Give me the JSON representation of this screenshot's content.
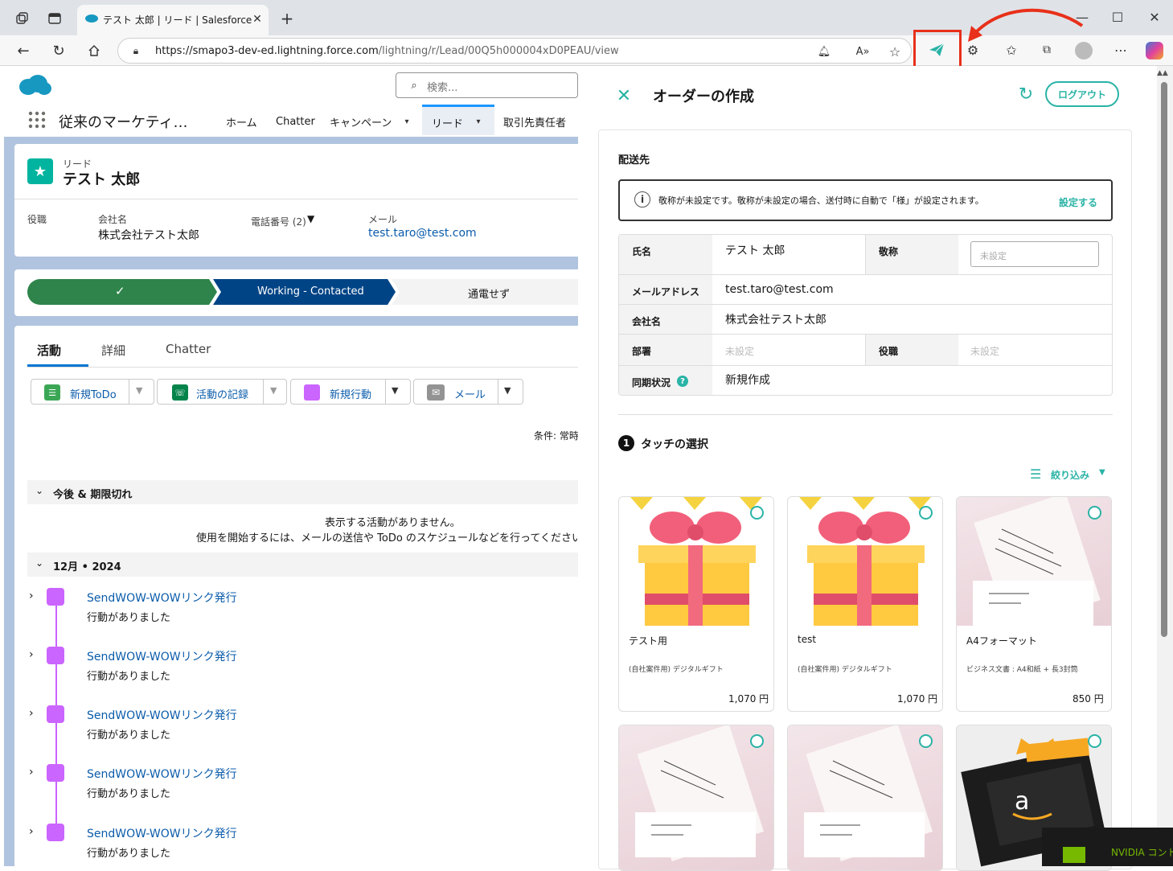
{
  "browser": {
    "tab_title": "テスト 太郎 | リード | Salesforce",
    "url_base": "https://smapo3-dev-ed.lightning.force.com",
    "url_path": "/lightning/r/Lead/00Q5h000004xD0PEAU/view"
  },
  "sf": {
    "search_placeholder": "検索...",
    "app_name": "従来のマーケティ…",
    "nav": [
      "ホーム",
      "Chatter",
      "キャンペーン",
      "リード",
      "取引先責任者"
    ],
    "record_type": "リード",
    "record_name": "テスト 太郎",
    "fields": {
      "title_label": "役職",
      "company_label": "会社名",
      "company_value": "株式会社テスト太郎",
      "phone_label": "電話番号 (2)",
      "email_label": "メール",
      "email_value": "test.taro@test.com"
    },
    "path": {
      "check": "✓",
      "current": "Working - Contacted",
      "next": "通電せず"
    },
    "tabs": [
      "活動",
      "詳細",
      "Chatter"
    ],
    "actions": [
      "新規ToDo",
      "活動の記録",
      "新規行動",
      "メール"
    ],
    "filter_text": "条件: 常時",
    "section_upcoming": "今後 & 期限切れ",
    "empty1": "表示する活動がありません。",
    "empty2": "使用を開始するには、メールの送信や ToDo のスケジュールなどを行ってください",
    "section_month": "12月 • 2024",
    "timeline": [
      {
        "title": "SendWOW-WOWリンク発行",
        "sub": "行動がありました"
      },
      {
        "title": "SendWOW-WOWリンク発行",
        "sub": "行動がありました"
      },
      {
        "title": "SendWOW-WOWリンク発行",
        "sub": "行動がありました"
      },
      {
        "title": "SendWOW-WOWリンク発行",
        "sub": "行動がありました"
      },
      {
        "title": "SendWOW-WOWリンク発行",
        "sub": "行動がありました"
      }
    ]
  },
  "panel": {
    "title": "オーダーの作成",
    "logout": "ログアウト",
    "ship_to": "配送先",
    "notice": "敬称が未設定です。敬称が未設定の場合、送付時に自動で「様」が設定されます。",
    "notice_link": "設定する",
    "rows": {
      "name_label": "氏名",
      "name_value": "テスト 太郎",
      "honorific_label": "敬称",
      "honorific_placeholder": "未設定",
      "email_label": "メールアドレス",
      "email_value": "test.taro@test.com",
      "company_label": "会社名",
      "company_value": "株式会社テスト太郎",
      "dept_label": "部署",
      "dept_value": "未設定",
      "role_label": "役職",
      "role_value": "未設定",
      "sync_label": "同期状況",
      "sync_value": "新規作成"
    },
    "step_num": "1",
    "step_title": "タッチの選択",
    "filter": "絞り込み",
    "products": [
      {
        "name": "テスト用",
        "desc": "(自社案件用) デジタルギフト",
        "price": "1,070 円"
      },
      {
        "name": "test",
        "desc": "(自社案件用) デジタルギフト",
        "price": "1,070 円"
      },
      {
        "name": "A4フォーマット",
        "desc": "ビジネス文書 : A4和紙 + 長3封筒",
        "price": "850 円"
      }
    ]
  },
  "overlay": {
    "nvidia": "NVIDIA コント"
  },
  "colors": {
    "accent": "#2ab3a6",
    "sf_blue": "#0b5cab",
    "path_green": "#2e844a",
    "path_navy": "#014486",
    "highlight": "#e8301a"
  }
}
